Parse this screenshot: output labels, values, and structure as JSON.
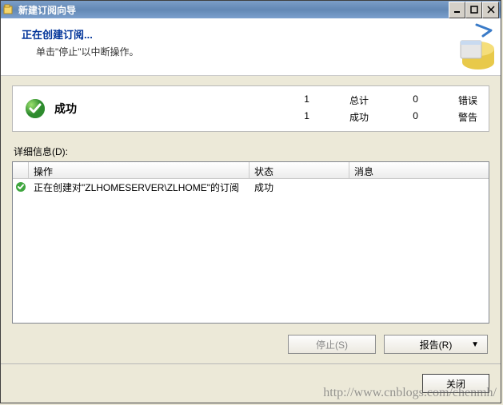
{
  "titlebar": {
    "title": "新建订阅向导"
  },
  "header": {
    "title": "正在创建订阅...",
    "subtitle": "单击\"停止\"以中断操作。"
  },
  "summary": {
    "status_label": "成功",
    "stats": {
      "total_num": "1",
      "total_label": "总计",
      "success_num": "1",
      "success_label": "成功",
      "error_num": "0",
      "error_label": "错误",
      "warning_num": "0",
      "warning_label": "警告"
    }
  },
  "details": {
    "label": "详细信息(D):",
    "columns": {
      "action": "操作",
      "status": "状态",
      "message": "消息"
    },
    "rows": [
      {
        "action": "正在创建对\"ZLHOMESERVER\\ZLHOME\"的订阅",
        "status": "成功",
        "message": ""
      }
    ]
  },
  "buttons": {
    "stop": "停止(S)",
    "report": "报告(R)",
    "close": "关闭"
  },
  "watermark": "http://www.cnblogs.com/chenmh/"
}
